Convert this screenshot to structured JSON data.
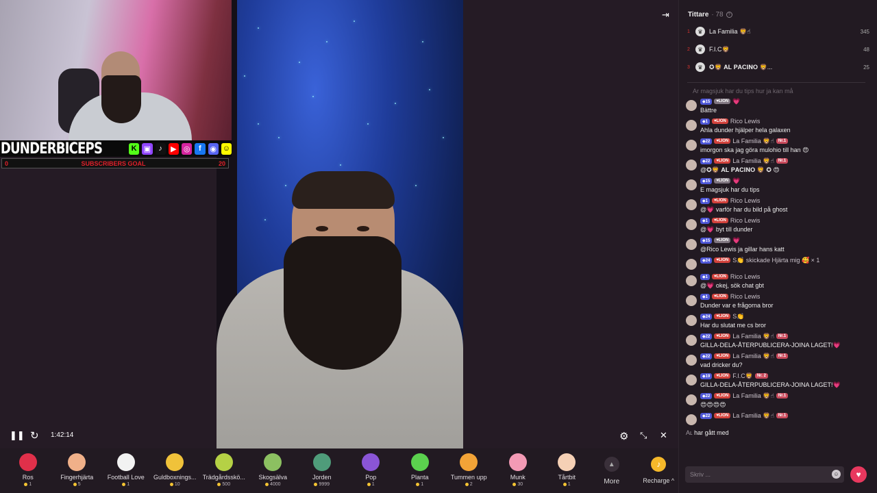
{
  "overlay": {
    "brand": "DUNDERBICEPS",
    "goal_label": "SUBSCRIBERS GOAL",
    "goal_left": "0",
    "goal_right": "20",
    "social_icons": [
      "kick-icon",
      "twitch-icon",
      "tiktok-icon",
      "youtube-icon",
      "instagram-icon",
      "facebook-icon",
      "discord-icon",
      "snapchat-icon"
    ]
  },
  "player": {
    "time": "1:42:14"
  },
  "gifts": [
    {
      "name": "Ros",
      "price": "1",
      "icon": "rose-icon",
      "color": "#e0304a"
    },
    {
      "name": "Fingerhjärta",
      "price": "5",
      "icon": "finger-heart-icon",
      "color": "#f0b089"
    },
    {
      "name": "Football Love",
      "price": "1",
      "icon": "football-icon",
      "color": "#f2f2f2"
    },
    {
      "name": "Guldboxnings...",
      "price": "10",
      "icon": "gold-glove-icon",
      "color": "#f0c23a"
    },
    {
      "name": "Trädgårdsskö...",
      "price": "500",
      "icon": "garden-icon",
      "color": "#b5d145"
    },
    {
      "name": "Skogsälva",
      "price": "4000",
      "icon": "forest-fairy-icon",
      "color": "#8cc061"
    },
    {
      "name": "Jorden",
      "price": "9999",
      "icon": "earth-icon",
      "color": "#4f9c7a"
    },
    {
      "name": "Pop",
      "price": "1",
      "icon": "pop-icon",
      "color": "#8a55d6"
    },
    {
      "name": "Planta",
      "price": "1",
      "icon": "plant-icon",
      "color": "#5bd14e"
    },
    {
      "name": "Tummen upp",
      "price": "2",
      "icon": "thumbs-up-icon",
      "color": "#f2a337"
    },
    {
      "name": "Munk",
      "price": "30",
      "icon": "donut-icon",
      "color": "#f39ab5"
    },
    {
      "name": "Tårtbit",
      "price": "1",
      "icon": "cake-icon",
      "color": "#f5d0b5"
    }
  ],
  "more_label": "More",
  "recharge_label": "Recharge",
  "viewers": {
    "title": "Tittare",
    "count": "· 78",
    "top": [
      {
        "rank": "1",
        "name": "La Familia 🦁☝",
        "score": "345"
      },
      {
        "rank": "2",
        "name": "F.I.C🦁",
        "score": "48"
      },
      {
        "rank": "3",
        "name": "✪🦁 𝐀𝐋 𝐏𝐀𝐂𝐈𝐍𝐎 🦁...",
        "score": "25"
      }
    ]
  },
  "chat": {
    "faded": "Ar magsjuk har du tips hur ja kan må",
    "messages": [
      {
        "level": "15",
        "fan": "LION",
        "grey": true,
        "user": "💗",
        "text": "Bättre",
        "nr": ""
      },
      {
        "level": "1",
        "fan": "LION",
        "grey": false,
        "user": "Rico Lewis",
        "text": "Ahla dunder hjälper hela galaxen",
        "nr": ""
      },
      {
        "level": "22",
        "fan": "LION",
        "grey": false,
        "user": "La Familia 🦁☝",
        "text": "imorgon ska jag göra mulohio till han 😍",
        "nr": "Nr.1"
      },
      {
        "level": "22",
        "fan": "LION",
        "grey": false,
        "user": "La Familia 🦁☝",
        "text": "@✪🦁 𝐀𝐋 𝐏𝐀𝐂𝐈𝐍𝐎 🦁 ✪ 😍",
        "nr": "Nr.1"
      },
      {
        "level": "15",
        "fan": "LION",
        "grey": true,
        "user": "💗",
        "text": "E magsjuk har du tips",
        "nr": ""
      },
      {
        "level": "1",
        "fan": "LION",
        "grey": false,
        "user": "Rico Lewis",
        "text": "@💗 varför har du bild på ghost",
        "nr": ""
      },
      {
        "level": "1",
        "fan": "LION",
        "grey": false,
        "user": "Rico Lewis",
        "text": "@💗 byt till dunder",
        "nr": ""
      },
      {
        "level": "15",
        "fan": "LION",
        "grey": true,
        "user": "💗",
        "text": "@Rico Lewis ja gillar hans katt",
        "nr": ""
      },
      {
        "level": "24",
        "fan": "LION",
        "grey": false,
        "user": "S👏 skickade Hjärta mig 🥰 × 1",
        "text": "",
        "nr": "",
        "system": true
      },
      {
        "level": "1",
        "fan": "LION",
        "grey": false,
        "user": "Rico Lewis",
        "text": "@💗 okej, sök chat gbt",
        "nr": ""
      },
      {
        "level": "1",
        "fan": "LION",
        "grey": false,
        "user": "Rico Lewis",
        "text": "Dunder var e frågorna bror",
        "nr": ""
      },
      {
        "level": "24",
        "fan": "LION",
        "grey": false,
        "user": "S👏",
        "text": "Har du slutat me cs bror",
        "nr": ""
      },
      {
        "level": "22",
        "fan": "LION",
        "grey": false,
        "user": "La Familia 🦁☝",
        "text": "GILLA-DELA-ÅTERPUBLICERA-JOINA LAGET!💗",
        "nr": "Nr.1"
      },
      {
        "level": "22",
        "fan": "LION",
        "grey": false,
        "user": "La Familia 🦁☝",
        "text": "vad dricker du?",
        "nr": "Nr.1"
      },
      {
        "level": "19",
        "fan": "LION",
        "grey": false,
        "user": "F.I.C🦁",
        "text": "GILLA-DELA-ÅTERPUBLICERA-JOINA LAGET!💗",
        "nr": "Nr. 2"
      },
      {
        "level": "22",
        "fan": "LION",
        "grey": false,
        "user": "La Familia 🦁☝",
        "text": "😍😍😍😍",
        "nr": "Nr.1"
      },
      {
        "level": "22",
        "fan": "LION",
        "grey": false,
        "user": "La Familia 🦁☝",
        "text": "",
        "nr": "Nr.1"
      }
    ],
    "joined": "har gått med",
    "joined_prefix": "Aʟ",
    "input_placeholder": "Skriv ..."
  }
}
